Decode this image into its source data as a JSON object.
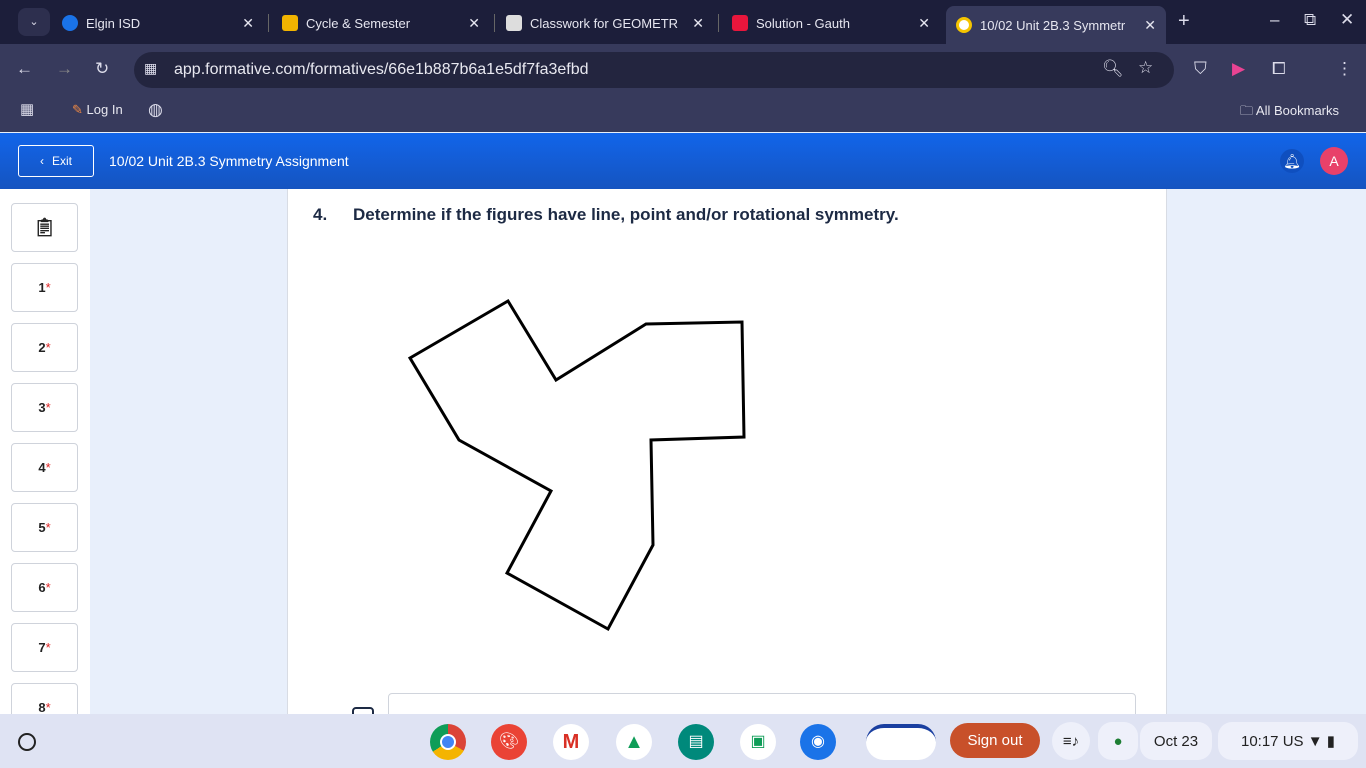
{
  "tabs": [
    {
      "label": "Elgin ISD",
      "color": "#1a73e8"
    },
    {
      "label": "Cycle & Semester",
      "color": "#f2b400"
    },
    {
      "label": "Classwork for GEOMETR",
      "color": "#333"
    },
    {
      "label": "Solution - Gauth",
      "color": "#e8163c"
    },
    {
      "label": "10/02 Unit 2B.3 Symmetr",
      "color": "#f5c400",
      "active": true
    }
  ],
  "url": "app.formative.com/formatives/66e1b887b6a1e5df7fa3efbd",
  "bookmarks": {
    "login": "Log In",
    "all": "All Bookmarks"
  },
  "appbar": {
    "exit": "Exit",
    "title": "10/02 Unit 2B.3 Symmetry Assignment",
    "avatar": "A"
  },
  "questions": [
    "1",
    "2",
    "3",
    "4",
    "5",
    "6",
    "7",
    "8"
  ],
  "required_mark": "*",
  "question": {
    "number": "4.",
    "text": "Determine if the figures have line, point and/or rotational symmetry."
  },
  "shelf": {
    "signout": "Sign out",
    "date": "Oct 23",
    "time": "10:17",
    "locale": "US"
  }
}
